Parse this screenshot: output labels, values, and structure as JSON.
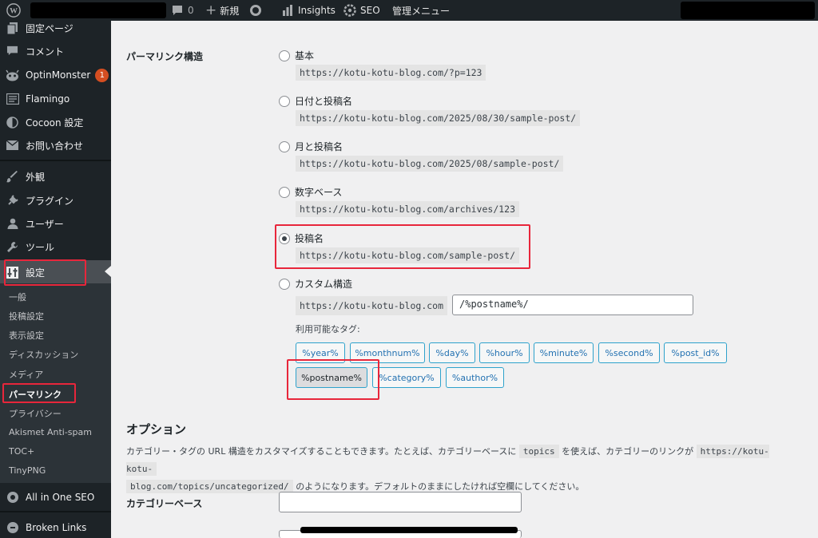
{
  "adminbar": {
    "comments_count": "0",
    "new_label": "新規",
    "insights_label": "Insights",
    "seo_label": "SEO",
    "admin_menu_label": "管理メニュー"
  },
  "sidebar": {
    "items": [
      {
        "label": "固定ページ",
        "icon": "page-icon"
      },
      {
        "label": "コメント",
        "icon": "comment-icon"
      },
      {
        "label": "OptinMonster",
        "icon": "optinmonster-icon",
        "badge": "1"
      },
      {
        "label": "Flamingo",
        "icon": "flamingo-icon"
      },
      {
        "label": "Cocoon 設定",
        "icon": "cocoon-icon"
      },
      {
        "label": "お問い合わせ",
        "icon": "mail-icon"
      },
      {
        "label": "外観",
        "icon": "appearance-icon"
      },
      {
        "label": "プラグイン",
        "icon": "plugin-icon"
      },
      {
        "label": "ユーザー",
        "icon": "user-icon"
      },
      {
        "label": "ツール",
        "icon": "tools-icon"
      },
      {
        "label": "設定",
        "icon": "settings-icon"
      }
    ],
    "submenu": [
      "一般",
      "投稿設定",
      "表示設定",
      "ディスカッション",
      "メディア",
      "パーマリンク",
      "プライバシー",
      "Akismet Anti-spam",
      "TOC+",
      "TinyPNG"
    ],
    "bottom_items": [
      {
        "label": "All in One SEO",
        "icon": "aioseo-icon"
      },
      {
        "label": "Broken Links",
        "icon": "broken-links-icon"
      }
    ]
  },
  "permalink": {
    "section_label": "パーマリンク構造",
    "options": [
      {
        "label": "基本",
        "example": "https://kotu-kotu-blog.com/?p=123",
        "checked": false
      },
      {
        "label": "日付と投稿名",
        "example": "https://kotu-kotu-blog.com/2025/08/30/sample-post/",
        "checked": false
      },
      {
        "label": "月と投稿名",
        "example": "https://kotu-kotu-blog.com/2025/08/sample-post/",
        "checked": false
      },
      {
        "label": "数字ベース",
        "example": "https://kotu-kotu-blog.com/archives/123",
        "checked": false
      },
      {
        "label": "投稿名",
        "example": "https://kotu-kotu-blog.com/sample-post/",
        "checked": true
      },
      {
        "label": "カスタム構造",
        "checked": false
      }
    ],
    "custom_base": "https://kotu-kotu-blog.com",
    "custom_value": "/%postname%/",
    "available_tags_label": "利用可能なタグ:",
    "tags_row1": [
      "%year%",
      "%monthnum%",
      "%day%",
      "%hour%",
      "%minute%",
      "%second%",
      "%post_id%"
    ],
    "tags_row2": [
      "%postname%",
      "%category%",
      "%author%"
    ]
  },
  "options": {
    "title": "オプション",
    "desc_part1": "カテゴリー・タグの URL 構造をカスタマイズすることもできます。たとえば、カテゴリーベースに",
    "desc_code1": "topics",
    "desc_part2": "を使えば、カテゴリーのリンクが",
    "desc_code2a": "https://kotu-kotu-",
    "desc_code2b": "blog.com/topics/uncategorized/",
    "desc_part3": "のようになります。デフォルトのままにしたければ空欄にしてください。",
    "category_base_label": "カテゴリーベース"
  }
}
